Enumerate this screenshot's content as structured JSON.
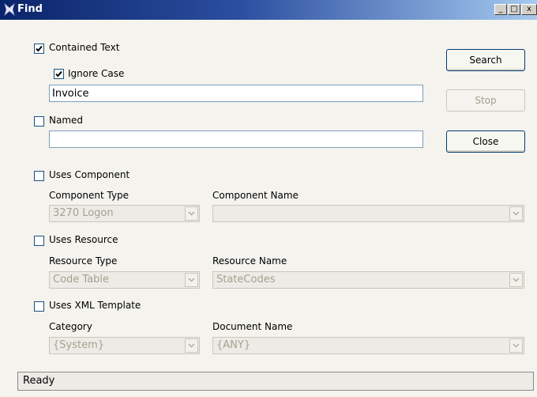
{
  "window": {
    "title": "Find",
    "minimize": "_",
    "maximize": "□",
    "close": "x"
  },
  "contained_text": {
    "label": "Contained Text",
    "checked": true
  },
  "ignore_case": {
    "label": "Ignore Case",
    "checked": true
  },
  "search_text": {
    "value": "Invoice"
  },
  "named": {
    "label": "Named",
    "checked": false,
    "value": ""
  },
  "buttons": {
    "search": "Search",
    "stop": "Stop",
    "close": "Close"
  },
  "uses_component": {
    "label": "Uses Component",
    "checked": false,
    "type_label": "Component Type",
    "type_value": "3270 Logon",
    "name_label": "Component Name",
    "name_value": ""
  },
  "uses_resource": {
    "label": "Uses Resource",
    "checked": false,
    "type_label": "Resource Type",
    "type_value": "Code Table",
    "name_label": "Resource Name",
    "name_value": "StateCodes"
  },
  "uses_xml": {
    "label": "Uses XML Template",
    "checked": false,
    "type_label": "Category",
    "type_value": "{System}",
    "name_label": "Document Name",
    "name_value": "{ANY}"
  },
  "status": {
    "text": "Ready"
  }
}
